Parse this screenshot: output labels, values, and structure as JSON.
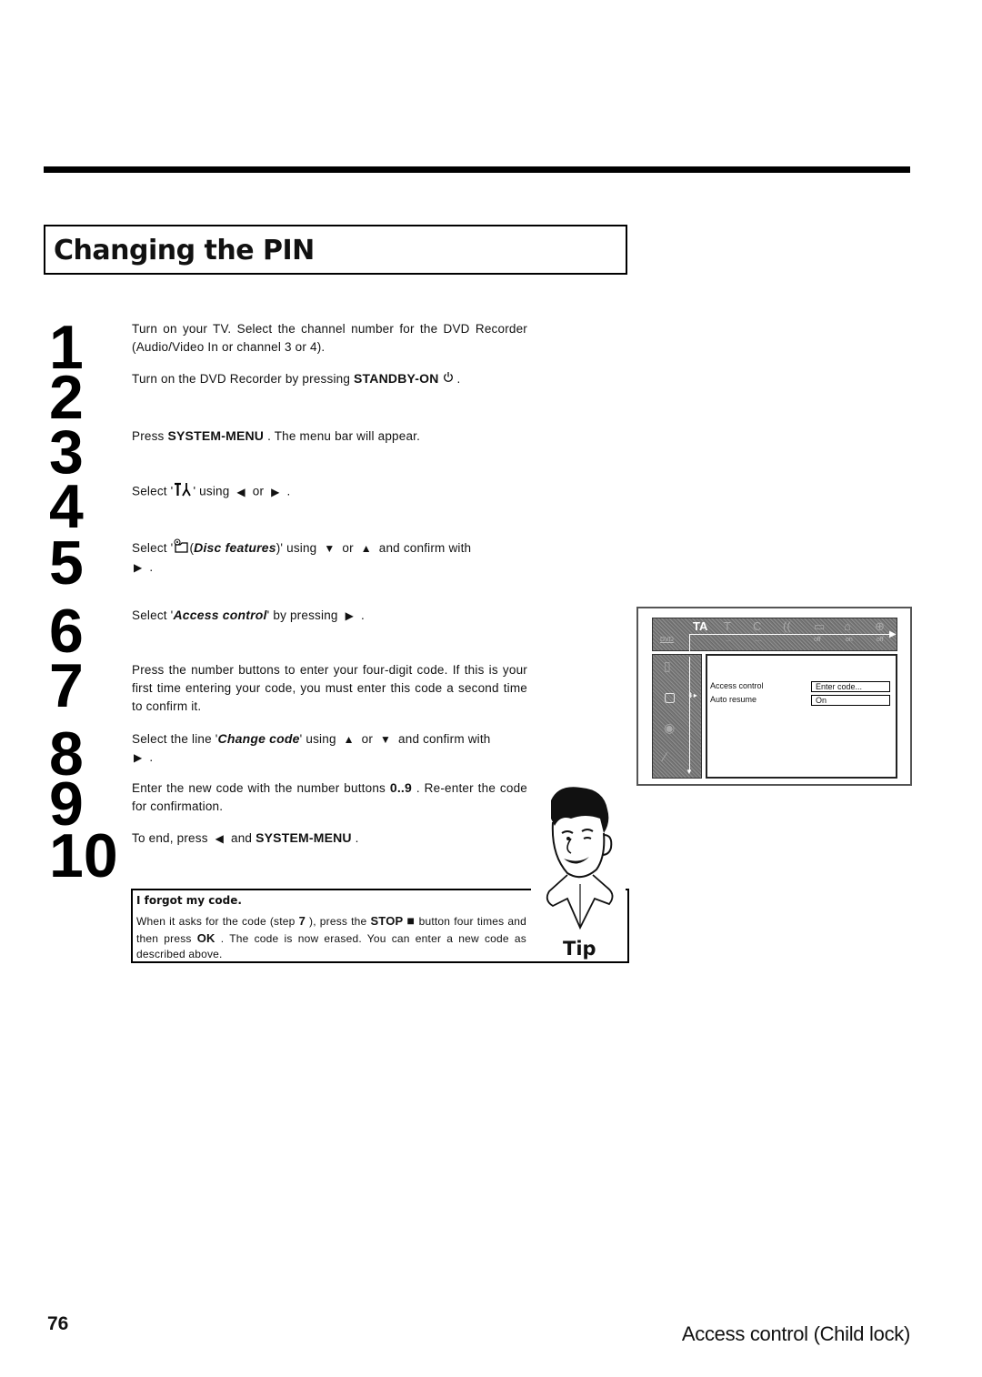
{
  "section": {
    "title": "Changing the PIN"
  },
  "steps": [
    {
      "number": "1",
      "parts": [
        "Turn on your TV. Select the channel number for the DVD Recorder (Audio/Video In or channel 3 or 4)."
      ]
    },
    {
      "number": "2",
      "pre": "Turn on the DVD Recorder by pressing ",
      "key": "STANDBY-ON",
      "icon": "power-icon",
      "post": " ."
    },
    {
      "number": "3",
      "pre": "Press ",
      "key": "SYSTEM-MENU",
      "post": " . The menu bar will appear."
    },
    {
      "number": "4",
      "pre": "Select '",
      "icon": "settings-tools-icon",
      "mid": "' using ",
      "arrow1": "◀",
      "or": " or ",
      "arrow2": "▶",
      "post": " ."
    },
    {
      "number": "5",
      "pre": "Select '",
      "icon": "disc-features-icon",
      "label": "Disc features",
      "mid": ")' using ",
      "arrow1": "▼",
      "or": " or ",
      "arrow2": "▲",
      "post": " and confirm with",
      "arrow3": "▶",
      "end": " ."
    },
    {
      "number": "6",
      "pre": "Select '",
      "label": "Access control",
      "mid": "' by pressing ",
      "arrow1": "▶",
      "post": " ."
    },
    {
      "number": "7",
      "parts": [
        "Press the number buttons to enter your four-digit code. If this is your first time entering your code, you must enter this code a second time to confirm it."
      ]
    },
    {
      "number": "8",
      "pre": "Select the line '",
      "label": "Change code",
      "mid": "' using ",
      "arrow1": "▲",
      "or": " or ",
      "arrow2": "▼",
      "post": " and confirm with",
      "arrow3": "▶",
      "end": " ."
    },
    {
      "number": "9",
      "pre": "Enter the new code with the number buttons ",
      "key": "0..9",
      "post": " . Re-enter the code for confirmation."
    },
    {
      "number": "10",
      "pre": "To end, press ",
      "arrow1": "◀",
      "mid": " and ",
      "key": "SYSTEM-MENU",
      "post": " ."
    }
  ],
  "tip": {
    "heading": "I forgot my code.",
    "body_pre": "When it asks for the code (step ",
    "step_ref": "7",
    "body_mid1": " ), press the ",
    "key_stop": "STOP",
    "stop_icon": "■",
    "body_mid2": " button four times and then press ",
    "key_ok": "OK",
    "body_post": " . The code is now erased. You can enter a new code as described above.",
    "label": "Tip"
  },
  "screen": {
    "menubar_icons": [
      "TA",
      "T",
      "C",
      "((",
      "▭",
      "⌂",
      "⊕"
    ],
    "menubar_sub": [
      "DVD",
      "...",
      "....",
      "off",
      "on",
      "off"
    ],
    "sidebar_icons": [
      "lock-icon",
      "disc-features-icon",
      "disc-icon",
      "wrench-icon"
    ],
    "rows": [
      {
        "label": "Access control",
        "value": "Enter code..."
      },
      {
        "label": "Auto resume",
        "value": "On"
      }
    ]
  },
  "footer": {
    "page_number": "76",
    "chapter": "Access control (Child lock)"
  }
}
